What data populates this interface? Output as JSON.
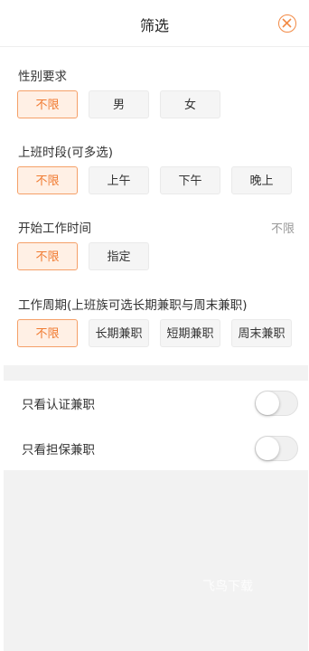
{
  "header": {
    "title": "筛选",
    "close_icon": "close-circle-icon",
    "accent": "#f28a45"
  },
  "sections": {
    "gender": {
      "title": "性别要求",
      "options": [
        "不限",
        "男",
        "女"
      ],
      "selected": "不限"
    },
    "time_slot": {
      "title": "上班时段(可多选)",
      "options": [
        "不限",
        "上午",
        "下午",
        "晚上"
      ],
      "selected": "不限"
    },
    "start_time": {
      "title": "开始工作时间",
      "value": "不限",
      "options": [
        "不限",
        "指定"
      ],
      "selected": "不限"
    },
    "period": {
      "title": "工作周期(上班族可选长期兼职与周末兼职)",
      "options": [
        "不限",
        "长期兼职",
        "短期兼职",
        "周末兼职"
      ],
      "selected": "不限"
    }
  },
  "toggles": [
    {
      "label": "只看认证兼职",
      "on": false
    },
    {
      "label": "只看担保兼职",
      "on": false
    }
  ],
  "watermark": "飞鸟下载"
}
